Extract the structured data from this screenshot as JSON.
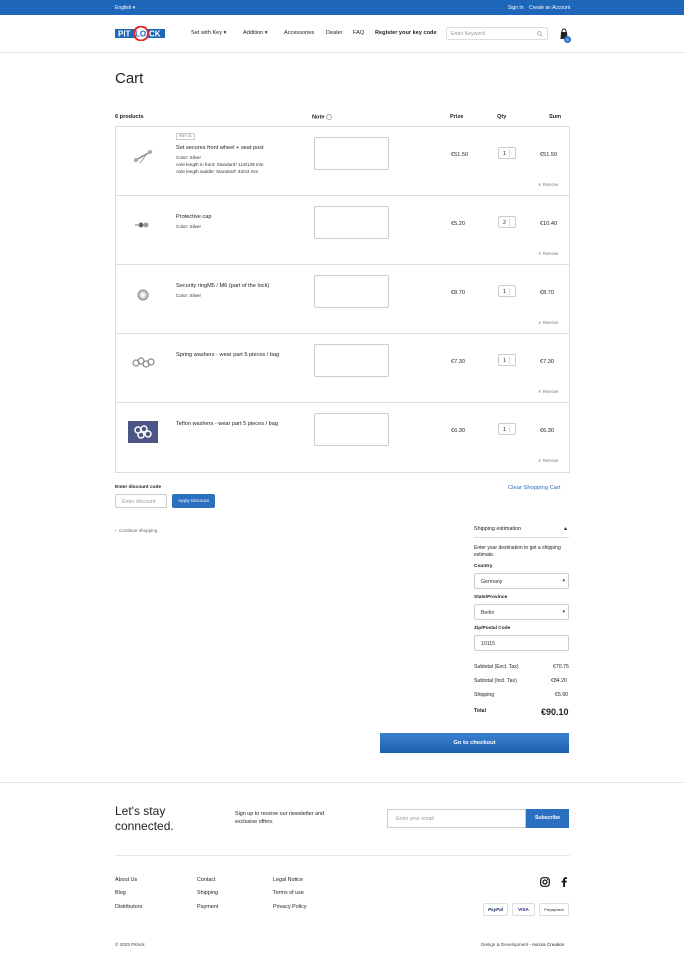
{
  "topbar": {
    "language": "English",
    "sign_in": "Sign In",
    "create_account": "Create an Account"
  },
  "header": {
    "logo_text": "PITLOCK",
    "nav": [
      "Set with Key",
      "Addition",
      "Accessories",
      "Dealer",
      "FAQ",
      "Register your key code"
    ],
    "search_placeholder": "Enter Keyword",
    "cart_count": "6"
  },
  "page_title": "Cart",
  "table_headers": {
    "products": "6 products",
    "note": "Note",
    "price": "Prize",
    "qty": "Qty",
    "sum": "Sum"
  },
  "items": [
    {
      "sku": "RST 01",
      "name": "Set secures front wheel + seat post",
      "attrs": [
        "Color: Silver",
        "Axle length in front: Standard* 119/129 mm",
        "Axle length saddle: Standard* 33/43 mm"
      ],
      "price": "€51.50",
      "qty": "1",
      "sum": "€51.50",
      "remove": "Remove"
    },
    {
      "name": "Protective cap",
      "attrs": [
        "Color: Silver"
      ],
      "price": "€5.20",
      "qty": "2",
      "sum": "€10.40",
      "remove": "Remove"
    },
    {
      "name": "Security ringM5 / M6 (part of the lock)",
      "attrs": [
        "Color: Silver"
      ],
      "price": "€8.70",
      "qty": "1",
      "sum": "€8.70",
      "remove": "Remove"
    },
    {
      "name": "Spring washers - wear part 5 pieces / bag",
      "attrs": [],
      "price": "€7.30",
      "qty": "1",
      "sum": "€7.30",
      "remove": "Remove"
    },
    {
      "name": "Teflon washers - wear part 5 pieces / bag",
      "attrs": [],
      "price": "€6.30",
      "qty": "1",
      "sum": "€6.30",
      "remove": "Remove"
    }
  ],
  "discount": {
    "label": "Enter discount code",
    "placeholder": "Enter discount",
    "button": "Apply Discount"
  },
  "clear_cart": "Clear Shopping Cart",
  "continue_shopping": "Continue shopping",
  "shipping": {
    "title": "Shipping estimation",
    "intro": "Enter your destination to get a shipping estimate.",
    "country_label": "Country",
    "country": "Germany",
    "state_label": "State/Province",
    "state": "Berlin",
    "zip_label": "Zip/Postal Code",
    "zip": "10115"
  },
  "totals": {
    "subtotal_excl_label": "Subtotal (Excl. Tax)",
    "subtotal_excl": "€70.75",
    "subtotal_incl_label": "Subtotal (Incl. Tax)",
    "subtotal_incl": "€84.20",
    "shipping_label": "Shipping",
    "shipping": "€5.90",
    "total_label": "Total",
    "total": "€90.10"
  },
  "checkout_button": "Go to checkout",
  "newsletter": {
    "heading_line1": "Let's stay",
    "heading_line2": "connected.",
    "text_line1": "Sign up to receive our newsletter and",
    "text_line2": "exclusive offers.",
    "placeholder": "Enter your email",
    "button": "Subscribe"
  },
  "footer": {
    "col1": [
      "About Us",
      "Blog",
      "Distributors"
    ],
    "col2": [
      "Contact",
      "Shipping",
      "Payment"
    ],
    "col3": [
      "Legal Notice",
      "Terms of use",
      "Privacy Policy"
    ],
    "payments": [
      "PayPal",
      "VISA",
      "Prepayment"
    ],
    "copyright": "© 2025 Pitlock",
    "credit_prefix": "Design & Development - ",
    "credit_name": "Aurora Creation"
  },
  "colors": {
    "brand": "#1e66b8",
    "button": "#2a6fc0",
    "logo_red": "#e02b2b"
  }
}
